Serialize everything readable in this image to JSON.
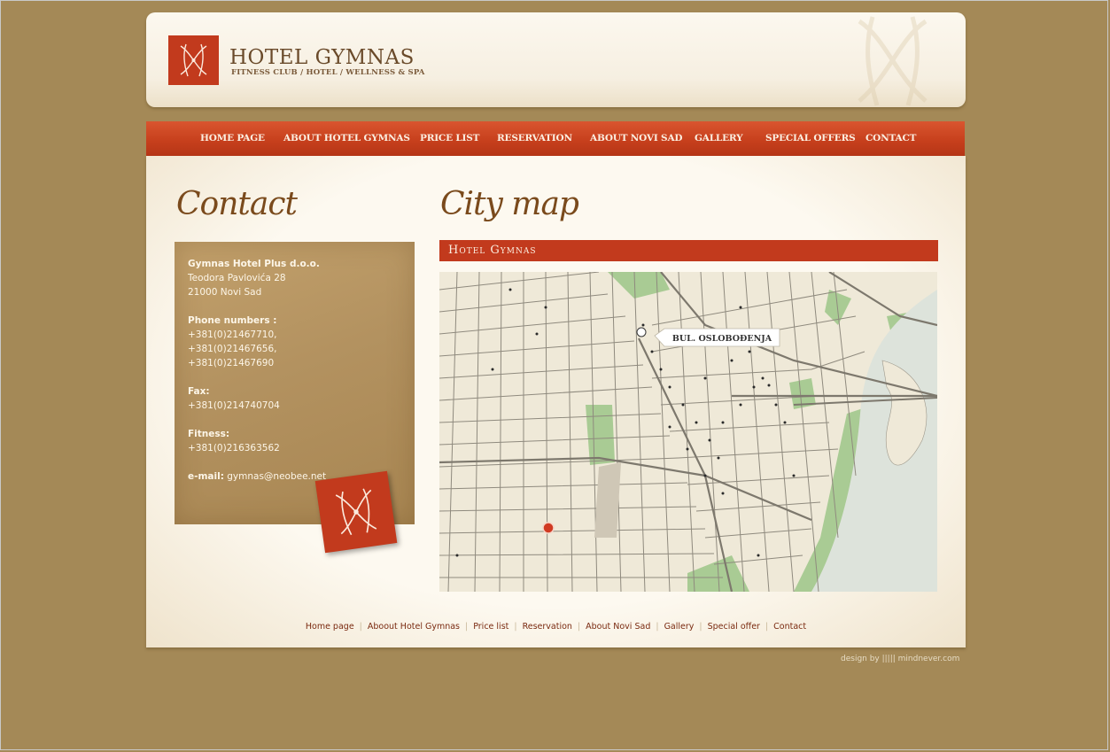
{
  "brand": {
    "title": "HOTEL GYMNAS",
    "subtitle": "FITNESS CLUB / HOTEL / WELLNESS & SPA"
  },
  "nav": [
    {
      "label": "HOME PAGE"
    },
    {
      "label": "ABOUT HOTEL GYMNAS"
    },
    {
      "label": "PRICE LIST"
    },
    {
      "label": "RESERVATION"
    },
    {
      "label": "ABOUT NOVI SAD"
    },
    {
      "label": "GALLERY"
    },
    {
      "label": "SPECIAL OFFERS"
    },
    {
      "label": "CONTACT"
    }
  ],
  "contact": {
    "heading": "Contact",
    "company": "Gymnas Hotel Plus d.o.o.",
    "street": "Teodora Pavlovića 28",
    "city": "21000 Novi Sad",
    "phone_label": "Phone numbers :",
    "phones": [
      "+381(0)21467710,",
      "+381(0)21467656,",
      "+381(0)21467690"
    ],
    "fax_label": "Fax:",
    "fax": "+381(0)214740704",
    "fitness_label": "Fitness:",
    "fitness": "+381(0)216363562",
    "email_label": "e-mail:",
    "email": "gymnas@neobee.net"
  },
  "map": {
    "heading": "City map",
    "bar_title": "Hotel Gymnas",
    "street_label": "BUL. OSLOBOĐENJA"
  },
  "footer": [
    {
      "label": "Home page"
    },
    {
      "label": "Aboout Hotel Gymnas"
    },
    {
      "label": "Price list"
    },
    {
      "label": "Reservation"
    },
    {
      "label": "About Novi Sad"
    },
    {
      "label": "Gallery"
    },
    {
      "label": "Special offer"
    },
    {
      "label": "Contact"
    }
  ],
  "credit": "design by  |||||  mindnever.com",
  "colors": {
    "background": "#a48957",
    "accent": "#c23a1d",
    "card": "#b39260",
    "river": "#dde3db",
    "park": "#9cc58a"
  }
}
